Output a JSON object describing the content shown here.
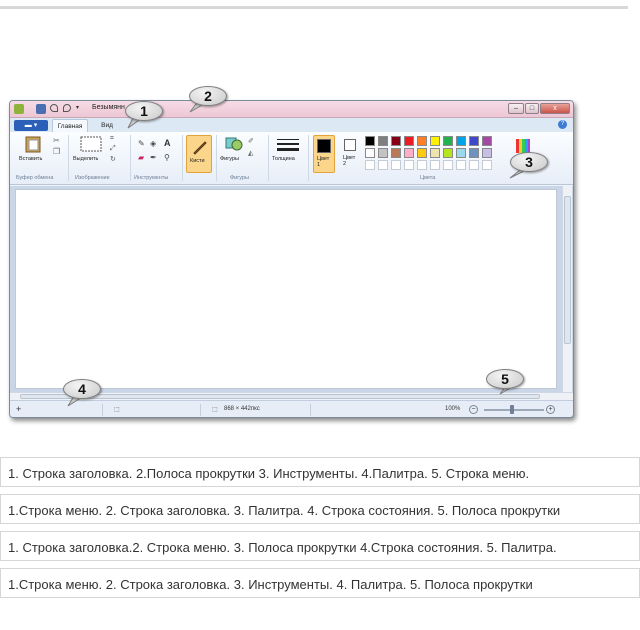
{
  "paint": {
    "title": "Безымянн",
    "file_tab": "▬ ▾",
    "tabs": [
      "Главная",
      "Вид"
    ],
    "groups": {
      "clipboard": "Буфер обмена",
      "image": "Изображение",
      "tools": "Инструменты",
      "shapes": "Фигуры",
      "colors": "Цвета"
    },
    "buttons": {
      "paste": "Вставить",
      "select": "Выделить",
      "brushes": "Кисти",
      "shapes": "Фигуры",
      "size": "Толщина",
      "color1": "Цвет 1",
      "color2": "Цвет 2"
    },
    "window_buttons": {
      "minimize": "–",
      "maximize": "□",
      "close": "x"
    },
    "status": {
      "canvas_size": "868 × 442пкс",
      "zoom": "100%"
    },
    "palette_row1": [
      "#000000",
      "#7f7f7f",
      "#880015",
      "#ed1c24",
      "#ff7f27",
      "#fff200",
      "#22b14c",
      "#00a2e8",
      "#3f48cc",
      "#a349a4"
    ],
    "palette_row2": [
      "#ffffff",
      "#c3c3c3",
      "#b97a57",
      "#ffaec9",
      "#ffc90e",
      "#efe4b0",
      "#b5e61d",
      "#99d9ea",
      "#7092be",
      "#c8bfe7"
    ]
  },
  "callouts": [
    "1",
    "2",
    "3",
    "4",
    "5"
  ],
  "options": [
    "1. Строка заголовка. 2.Полоса прокрутки 3. Инструменты. 4.Палитра. 5. Строка меню.",
    "1.Строка меню. 2. Строка заголовка. 3. Палитра. 4. Строка состояния. 5. Полоса прокрутки",
    "1. Строка заголовка.2. Строка меню. 3. Полоса прокрутки 4.Строка состояния. 5. Палитра.",
    "1.Строка меню. 2. Строка заголовка. 3. Инструменты. 4. Палитра. 5. Полоса прокрутки"
  ]
}
